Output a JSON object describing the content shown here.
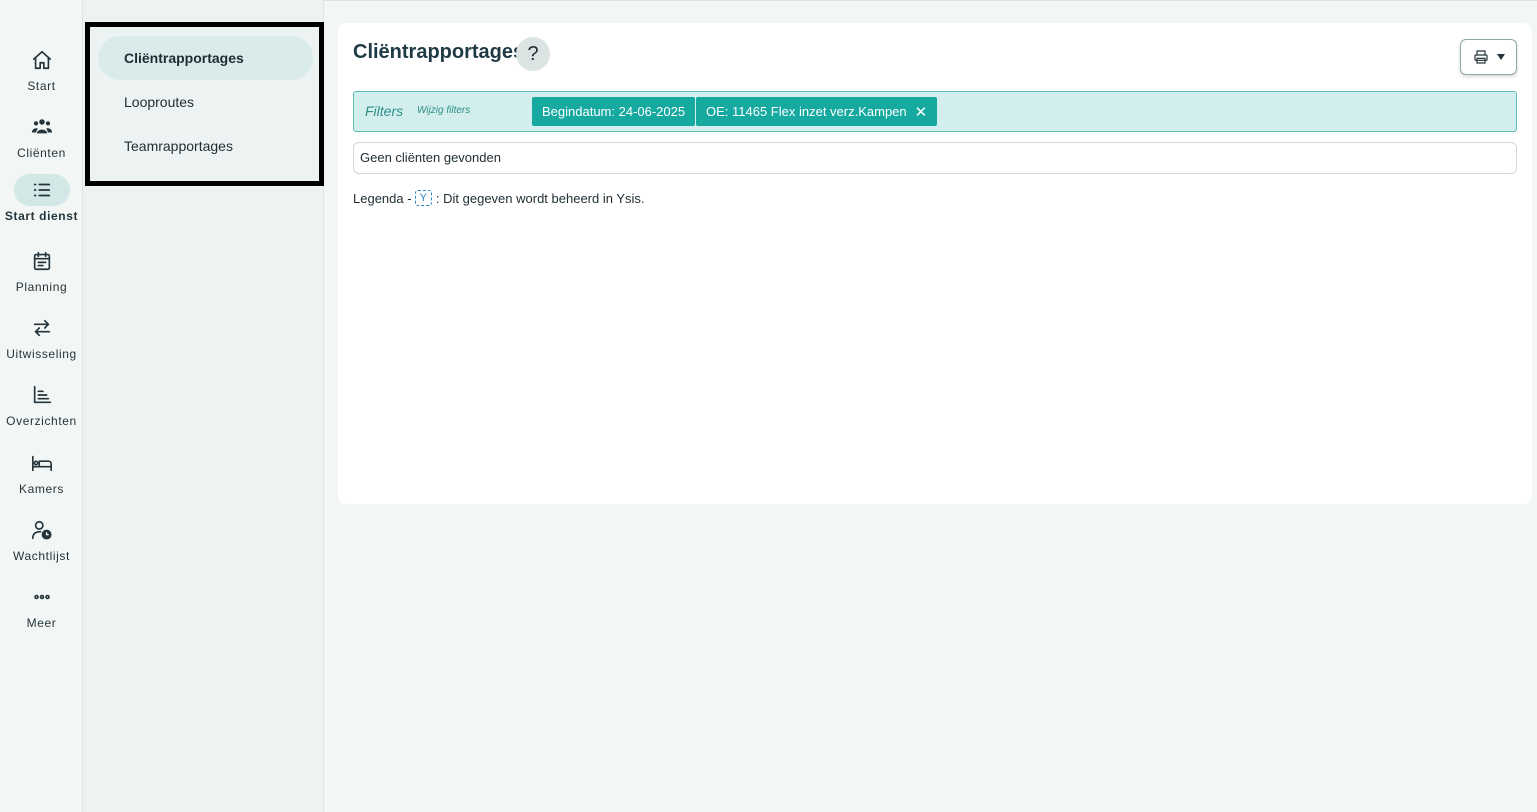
{
  "rail": {
    "items": [
      {
        "label": "Start",
        "icon": "home-icon"
      },
      {
        "label": "Cliënten",
        "icon": "users-icon"
      },
      {
        "label": "Start dienst",
        "icon": "list-icon"
      },
      {
        "label": "Planning",
        "icon": "calendar-icon"
      },
      {
        "label": "Uitwisseling",
        "icon": "exchange-icon"
      },
      {
        "label": "Overzichten",
        "icon": "chart-icon"
      },
      {
        "label": "Kamers",
        "icon": "bed-icon"
      },
      {
        "label": "Wachtlijst",
        "icon": "user-clock-icon"
      },
      {
        "label": "Meer",
        "icon": "more-icon"
      }
    ],
    "active": "Start dienst"
  },
  "submenu": {
    "items": [
      {
        "label": "Cliëntrapportages"
      },
      {
        "label": "Looproutes"
      },
      {
        "label": "Teamrapportages"
      }
    ],
    "active": "Cliëntrapportages"
  },
  "main": {
    "title": "Cliëntrapportages",
    "help_label": "?",
    "filters": {
      "label": "Filters",
      "edit_label": "Wijzig filters",
      "chips": [
        {
          "text": "Begindatum: 24-06-2025",
          "removable": false
        },
        {
          "text": "OE: 11465 Flex inzet verz.Kampen",
          "removable": true
        }
      ],
      "remove_glyph": "✕"
    },
    "empty_message": "Geen cliënten gevonden",
    "legend": {
      "prefix": "Legenda -",
      "badge": "Y",
      "text": ": Dit gegeven wordt beheerd in Ysis."
    }
  },
  "colors": {
    "accent": "#15a9a0",
    "filter_bg": "#d3efed",
    "active_bg": "#d3e8e6",
    "legend_badge": "#2f86c4"
  }
}
